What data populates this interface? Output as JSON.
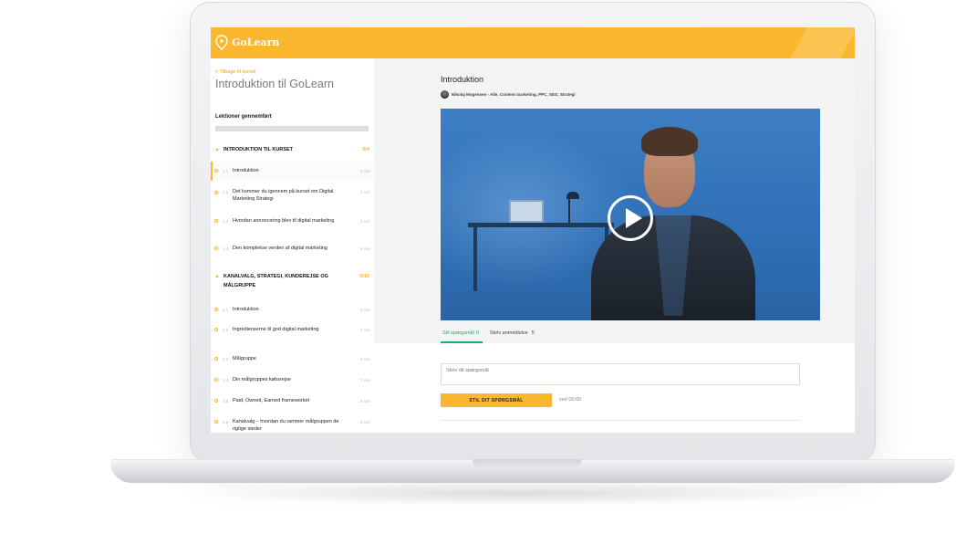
{
  "app": {
    "name": "GoLearn",
    "brand_color": "#fbb72d",
    "accent_green": "#1fae5b"
  },
  "sidebar": {
    "back_link": "< Tilbage til kurset",
    "course_title": "Introduktion til GoLearn",
    "progress_label": "Lektioner gennemført",
    "progress_fraction": 0,
    "sections": [
      {
        "title": "INTRODUKTION TIL KURSET",
        "count": "0/4",
        "lessons": [
          {
            "num": "1.1",
            "title": "Introduktion",
            "duration": "3 min"
          },
          {
            "num": "1.2",
            "title": "Det kommer du igennem på kurset om Digital Marketing Strategi",
            "duration": "2 min"
          },
          {
            "num": "1.3",
            "title": "Hvordan annoncering blev til digital marketing",
            "duration": "3 min"
          },
          {
            "num": "1.4",
            "title": "Den komplekse verden af digital marketing",
            "duration": "6 min"
          }
        ]
      },
      {
        "title": "KANALVALG, STRATEGI, KUNDEREJSE OG MÅLGRUPPE",
        "count": "0/10",
        "lessons": [
          {
            "num": "2.1",
            "title": "Introduktion",
            "duration": "3 min"
          },
          {
            "num": "2.2",
            "title": "Ingredienserne til god digital marketing",
            "duration": "4 min"
          },
          {
            "num": "2.3",
            "title": "Målgruppe",
            "duration": "6 min"
          },
          {
            "num": "2.4",
            "title": "Din målgruppes købsrejse",
            "duration": "7 min"
          },
          {
            "num": "2.5",
            "title": "Paid, Owned, Earned frameworket",
            "duration": "6 min"
          },
          {
            "num": "2.6",
            "title": "Kanalvalg – hvordan du rammer målgruppen de rigtige steder",
            "duration": "6 min"
          }
        ]
      }
    ]
  },
  "main": {
    "lesson_title": "Introduktion",
    "author_line": "Nikolaj Mogensen - Alle, Content marketing, PPC, SEO, Strategi",
    "video_icon": "play-icon",
    "tabs": [
      {
        "label": "Stil spørgsmål",
        "count": "0"
      },
      {
        "label": "Skriv anmeldelse",
        "count": "5"
      }
    ],
    "question_placeholder": "Skriv dit spørgsmål",
    "question_button": "STIL DIT SPØRGSMÅL",
    "question_time": "ved 00:00"
  }
}
